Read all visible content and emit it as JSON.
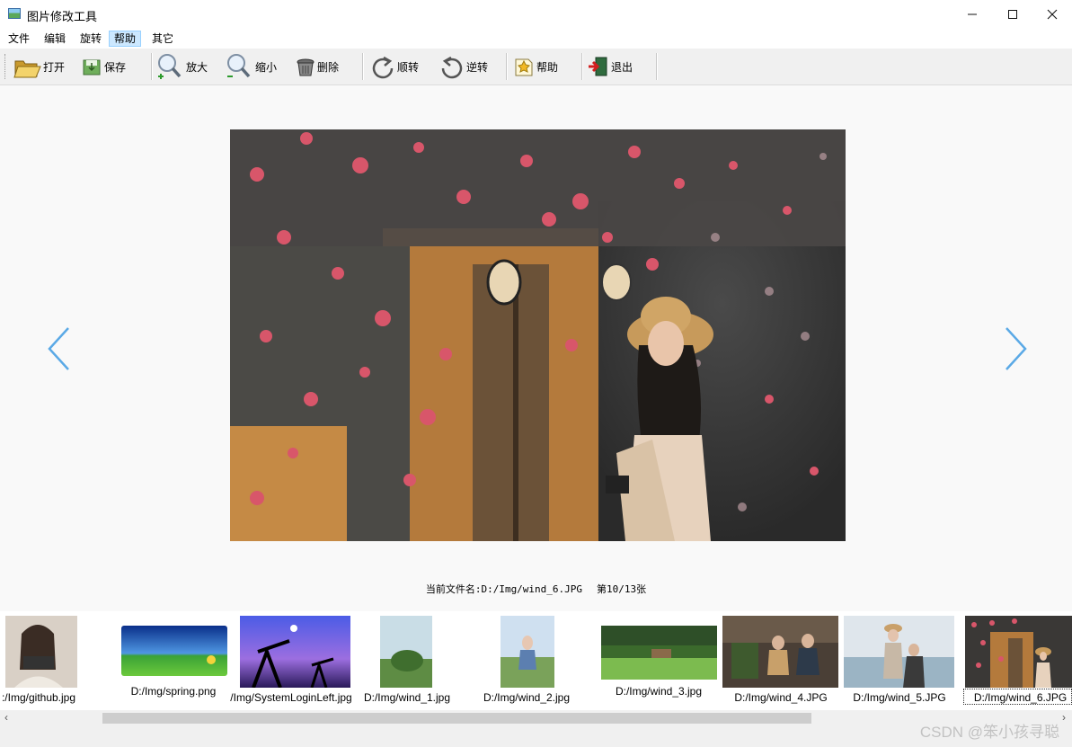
{
  "window": {
    "title": "图片修改工具",
    "minimize_icon": "minimize-icon",
    "maximize_icon": "maximize-icon",
    "close_icon": "close-icon"
  },
  "menu": [
    {
      "label": "文件",
      "active": false
    },
    {
      "label": "编辑",
      "active": false
    },
    {
      "label": "旋转",
      "active": false
    },
    {
      "label": "帮助",
      "active": true
    },
    {
      "label": "其它",
      "active": false
    }
  ],
  "toolbar": {
    "open": {
      "label": "打开",
      "icon": "folder-open-icon"
    },
    "save": {
      "label": "保存",
      "icon": "save-icon"
    },
    "zoom_in": {
      "label": "放大",
      "icon": "zoom-in-icon"
    },
    "zoom_out": {
      "label": "缩小",
      "icon": "zoom-out-icon"
    },
    "delete": {
      "label": "删除",
      "icon": "trash-icon"
    },
    "rotate_cw": {
      "label": "顺转",
      "icon": "rotate-clockwise-icon"
    },
    "rotate_ccw": {
      "label": "逆转",
      "icon": "rotate-counterclockwise-icon"
    },
    "help": {
      "label": "帮助",
      "icon": "help-icon"
    },
    "exit": {
      "label": "退出",
      "icon": "exit-icon"
    }
  },
  "viewer": {
    "prev_icon": "chevron-left-icon",
    "next_icon": "chevron-right-icon",
    "current_file": "当前文件名:D:/Img/wind_6.JPG",
    "position": "第10/13张"
  },
  "thumbnails": [
    {
      "caption": ":/Img/github.jpg",
      "selected": false
    },
    {
      "caption": "D:/Img/spring.png",
      "selected": false
    },
    {
      "caption": "/Img/SystemLoginLeft.jpg",
      "selected": false
    },
    {
      "caption": "D:/Img/wind_1.jpg",
      "selected": false
    },
    {
      "caption": "D:/Img/wind_2.jpg",
      "selected": false
    },
    {
      "caption": "D:/Img/wind_3.jpg",
      "selected": false
    },
    {
      "caption": "D:/Img/wind_4.JPG",
      "selected": false
    },
    {
      "caption": "D:/Img/wind_5.JPG",
      "selected": false
    },
    {
      "caption": "D:/Img/wind_6.JPG",
      "selected": true
    }
  ],
  "watermark": "CSDN @笨小孩寻聪",
  "colors": {
    "accent": "#5aa9e6",
    "menu_active": "#cce8ff",
    "toolbar_bg": "#f0f0f0"
  }
}
